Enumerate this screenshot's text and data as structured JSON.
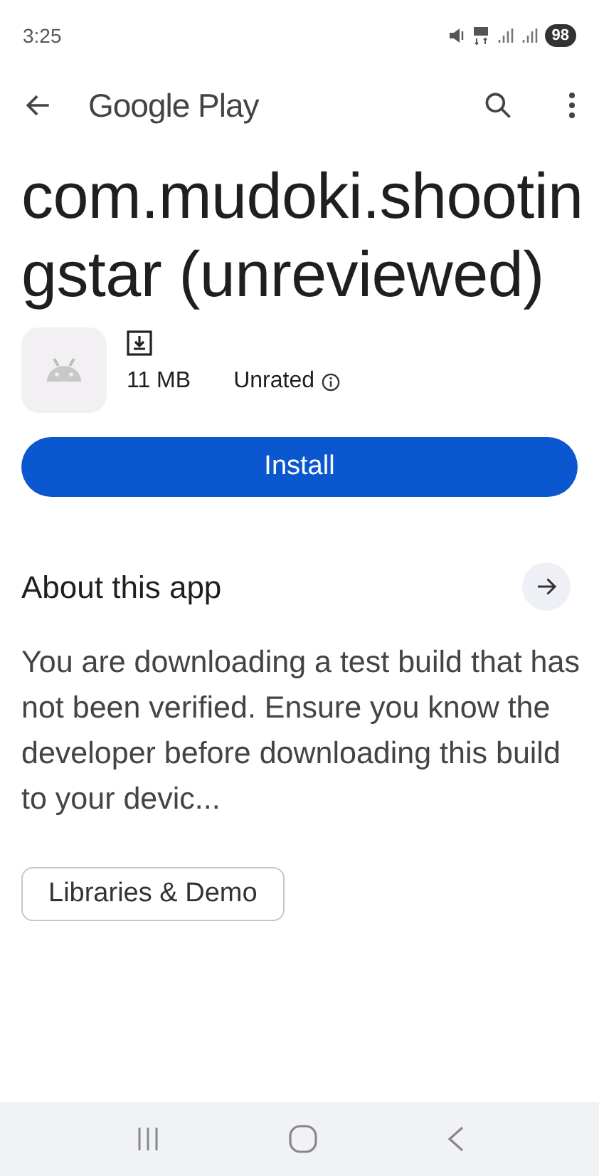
{
  "status_bar": {
    "time": "3:25",
    "battery": "98"
  },
  "app_bar": {
    "title": "Google Play"
  },
  "app": {
    "name": "com.mudoki.shootingstar (unreviewed)",
    "size": "11 MB",
    "rating": "Unrated"
  },
  "install_button": {
    "label": "Install"
  },
  "about": {
    "heading": "About this app",
    "description": "You are downloading a test build that has not been verified. Ensure you know the developer before downloading this build to your devic..."
  },
  "chips": [
    {
      "label": "Libraries & Demo"
    }
  ]
}
